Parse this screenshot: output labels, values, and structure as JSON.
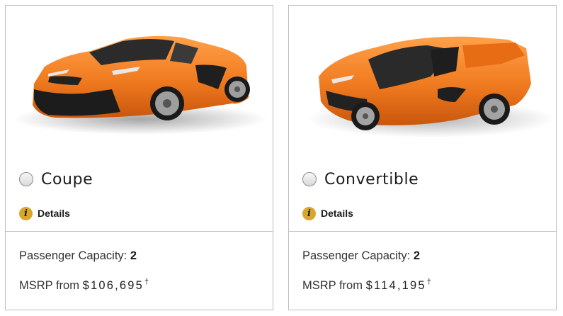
{
  "colors": {
    "accent_info": "#d9a52c",
    "border": "#bdbdbd",
    "car_orange": "#f07a1f"
  },
  "details_icon": "info-icon",
  "radio_icon": "radio-unselected",
  "cards": [
    {
      "option_label": "Coupe",
      "details_label": "Details",
      "capacity_label": "Passenger Capacity:",
      "capacity_value": "2",
      "msrp_label": "MSRP from",
      "msrp_value": "$106,695",
      "msrp_mark": "†",
      "selected": false
    },
    {
      "option_label": "Convertible",
      "details_label": "Details",
      "capacity_label": "Passenger Capacity:",
      "capacity_value": "2",
      "msrp_label": "MSRP from",
      "msrp_value": "$114,195",
      "msrp_mark": "†",
      "selected": false
    }
  ]
}
